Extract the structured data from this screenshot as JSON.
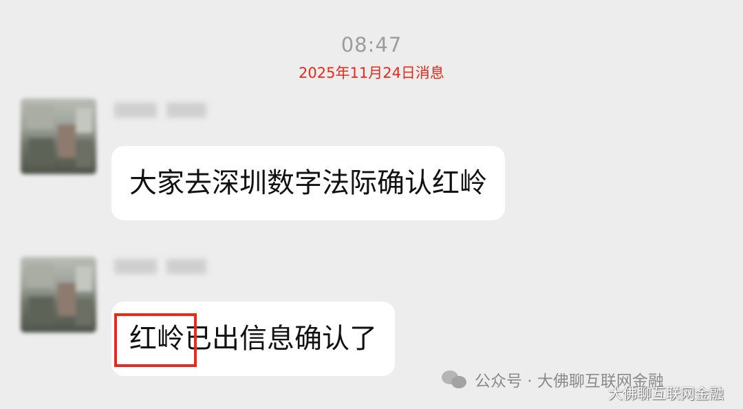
{
  "chat": {
    "time": "08:47",
    "annotation": "2025年11月24日消息",
    "messages": [
      {
        "text": "大家去深圳数字法际确认红岭"
      },
      {
        "highlight": "红岭",
        "rest": "已出信息确认了"
      }
    ]
  },
  "watermark": {
    "icon": "wechat-icon",
    "text": "公众号 · 大佛聊互联网金融",
    "overlay_text": "大佛聊互联网金融"
  },
  "colors": {
    "background": "#ededed",
    "bubble": "#ffffff",
    "annotation_red": "#e8291c",
    "time_gray": "#9c9c9c"
  }
}
